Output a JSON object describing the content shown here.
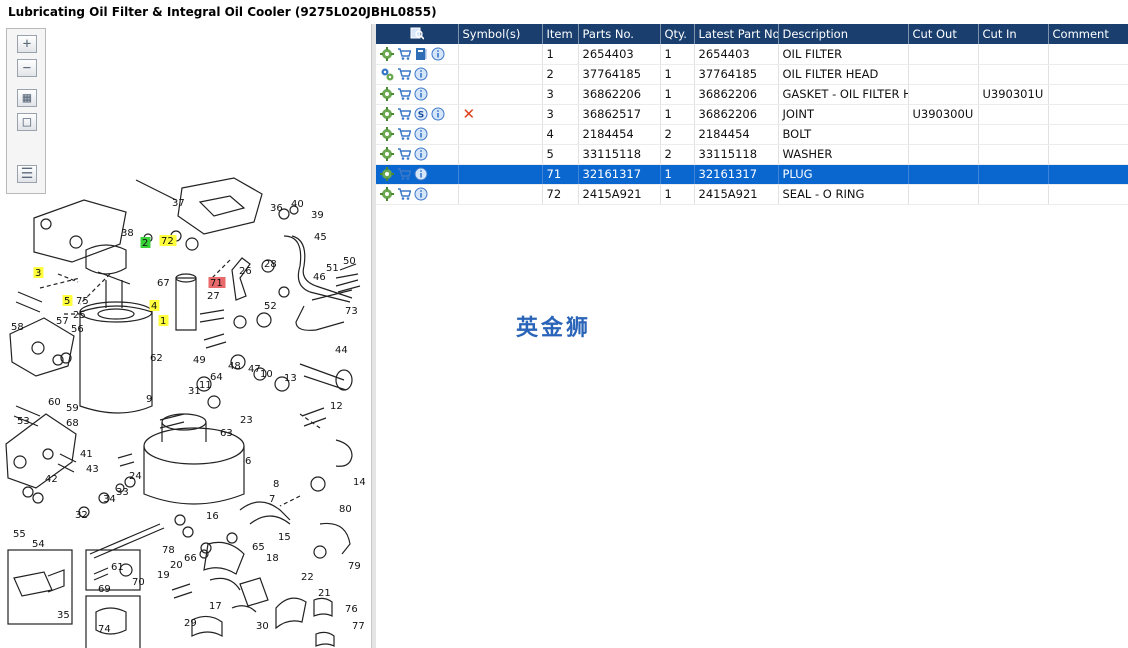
{
  "title": "Lubricating Oil Filter & Integral Oil Cooler (9275L020JBHL0855)",
  "toolbar": {
    "buttons": [
      {
        "name": "zoom-in",
        "glyph": "+"
      },
      {
        "name": "zoom-out",
        "glyph": "−"
      },
      {
        "name": "fit-page",
        "glyph": "▦"
      },
      {
        "name": "actual-size",
        "glyph": "□"
      },
      {
        "name": "list-view",
        "glyph": "☰"
      }
    ]
  },
  "table": {
    "headers": {
      "icons": "",
      "symbols": "Symbol(s)",
      "item": "Item",
      "parts_no": "Parts No.",
      "qty": "Qty.",
      "latest_part_no": "Latest Part No.",
      "description": "Description",
      "cut_out": "Cut Out",
      "cut_in": "Cut In",
      "comment": "Comment"
    },
    "rows": [
      {
        "item": "1",
        "parts_no": "2654403",
        "qty": "1",
        "latest_part_no": "2654403",
        "description": "OIL FILTER",
        "cut_out": "",
        "cut_in": "",
        "comment": "",
        "extra_icon": "book",
        "cancelled": false,
        "selected": false
      },
      {
        "item": "2",
        "parts_no": "37764185",
        "qty": "1",
        "latest_part_no": "37764185",
        "description": "OIL FILTER HEAD",
        "cut_out": "",
        "cut_in": "",
        "comment": "",
        "extra_icon": "",
        "cancelled": false,
        "selected": false
      },
      {
        "item": "3",
        "parts_no": "36862206",
        "qty": "1",
        "latest_part_no": "36862206",
        "description": "GASKET - OIL FILTER HEA",
        "cut_out": "",
        "cut_in": "U390301U",
        "comment": "",
        "extra_icon": "",
        "cancelled": false,
        "selected": false
      },
      {
        "item": "3",
        "parts_no": "36862517",
        "qty": "1",
        "latest_part_no": "36862206",
        "description": "JOINT",
        "cut_out": "U390300U",
        "cut_in": "",
        "comment": "",
        "extra_icon": "s",
        "cancelled": true,
        "selected": false
      },
      {
        "item": "4",
        "parts_no": "2184454",
        "qty": "2",
        "latest_part_no": "2184454",
        "description": "BOLT",
        "cut_out": "",
        "cut_in": "",
        "comment": "",
        "extra_icon": "",
        "cancelled": false,
        "selected": false
      },
      {
        "item": "5",
        "parts_no": "33115118",
        "qty": "2",
        "latest_part_no": "33115118",
        "description": "WASHER",
        "cut_out": "",
        "cut_in": "",
        "comment": "",
        "extra_icon": "",
        "cancelled": false,
        "selected": false
      },
      {
        "item": "71",
        "parts_no": "32161317",
        "qty": "1",
        "latest_part_no": "32161317",
        "description": "PLUG",
        "cut_out": "",
        "cut_in": "",
        "comment": "",
        "extra_icon": "",
        "cancelled": false,
        "selected": true
      },
      {
        "item": "72",
        "parts_no": "2415A921",
        "qty": "1",
        "latest_part_no": "2415A921",
        "description": "SEAL - O RING",
        "cut_out": "",
        "cut_in": "",
        "comment": "",
        "extra_icon": "",
        "cancelled": false,
        "selected": false
      }
    ]
  },
  "diagram": {
    "callouts": [
      {
        "label": "37",
        "highlight": ""
      },
      {
        "label": "36",
        "highlight": ""
      },
      {
        "label": "40",
        "highlight": ""
      },
      {
        "label": "39",
        "highlight": ""
      },
      {
        "label": "45",
        "highlight": ""
      },
      {
        "label": "38",
        "highlight": ""
      },
      {
        "label": "2",
        "highlight": "green"
      },
      {
        "label": "72",
        "highlight": "yellow"
      },
      {
        "label": "71",
        "highlight": "red"
      },
      {
        "label": "3",
        "highlight": "yellow"
      },
      {
        "label": "4",
        "highlight": "yellow"
      },
      {
        "label": "5",
        "highlight": "yellow"
      },
      {
        "label": "1",
        "highlight": "yellow"
      },
      {
        "label": "75",
        "highlight": ""
      },
      {
        "label": "67",
        "highlight": ""
      },
      {
        "label": "26",
        "highlight": ""
      },
      {
        "label": "28",
        "highlight": ""
      },
      {
        "label": "46",
        "highlight": ""
      },
      {
        "label": "50",
        "highlight": ""
      },
      {
        "label": "51",
        "highlight": ""
      },
      {
        "label": "73",
        "highlight": ""
      },
      {
        "label": "27",
        "highlight": ""
      },
      {
        "label": "52",
        "highlight": ""
      },
      {
        "label": "58",
        "highlight": ""
      },
      {
        "label": "25",
        "highlight": ""
      },
      {
        "label": "57",
        "highlight": ""
      },
      {
        "label": "56",
        "highlight": ""
      },
      {
        "label": "62",
        "highlight": ""
      },
      {
        "label": "44",
        "highlight": ""
      },
      {
        "label": "49",
        "highlight": ""
      },
      {
        "label": "48",
        "highlight": ""
      },
      {
        "label": "47",
        "highlight": ""
      },
      {
        "label": "64",
        "highlight": ""
      },
      {
        "label": "10",
        "highlight": ""
      },
      {
        "label": "13",
        "highlight": ""
      },
      {
        "label": "11",
        "highlight": ""
      },
      {
        "label": "31",
        "highlight": ""
      },
      {
        "label": "60",
        "highlight": ""
      },
      {
        "label": "59",
        "highlight": ""
      },
      {
        "label": "9",
        "highlight": ""
      },
      {
        "label": "23",
        "highlight": ""
      },
      {
        "label": "12",
        "highlight": ""
      },
      {
        "label": "53",
        "highlight": ""
      },
      {
        "label": "68",
        "highlight": ""
      },
      {
        "label": "63",
        "highlight": ""
      },
      {
        "label": "41",
        "highlight": ""
      },
      {
        "label": "43",
        "highlight": ""
      },
      {
        "label": "24",
        "highlight": ""
      },
      {
        "label": "6",
        "highlight": ""
      },
      {
        "label": "14",
        "highlight": ""
      },
      {
        "label": "42",
        "highlight": ""
      },
      {
        "label": "34",
        "highlight": ""
      },
      {
        "label": "33",
        "highlight": ""
      },
      {
        "label": "8",
        "highlight": ""
      },
      {
        "label": "7",
        "highlight": ""
      },
      {
        "label": "80",
        "highlight": ""
      },
      {
        "label": "32",
        "highlight": ""
      },
      {
        "label": "16",
        "highlight": ""
      },
      {
        "label": "15",
        "highlight": ""
      },
      {
        "label": "55",
        "highlight": ""
      },
      {
        "label": "54",
        "highlight": ""
      },
      {
        "label": "78",
        "highlight": ""
      },
      {
        "label": "66",
        "highlight": ""
      },
      {
        "label": "65",
        "highlight": ""
      },
      {
        "label": "18",
        "highlight": ""
      },
      {
        "label": "79",
        "highlight": ""
      },
      {
        "label": "61",
        "highlight": ""
      },
      {
        "label": "20",
        "highlight": ""
      },
      {
        "label": "19",
        "highlight": ""
      },
      {
        "label": "17",
        "highlight": ""
      },
      {
        "label": "22",
        "highlight": ""
      },
      {
        "label": "21",
        "highlight": ""
      },
      {
        "label": "35",
        "highlight": ""
      },
      {
        "label": "69",
        "highlight": ""
      },
      {
        "label": "70",
        "highlight": ""
      },
      {
        "label": "74",
        "highlight": ""
      },
      {
        "label": "29",
        "highlight": ""
      },
      {
        "label": "30",
        "highlight": ""
      },
      {
        "label": "76",
        "highlight": ""
      },
      {
        "label": "77",
        "highlight": ""
      }
    ]
  },
  "watermark": "英金狮",
  "colors": {
    "header_bg": "#1a3f6e",
    "selected_row": "#0a67d0",
    "highlight_yellow": "#ffff3c",
    "highlight_green": "#38d338",
    "highlight_red": "#e86a6a",
    "cancel_red": "#e0401c"
  }
}
